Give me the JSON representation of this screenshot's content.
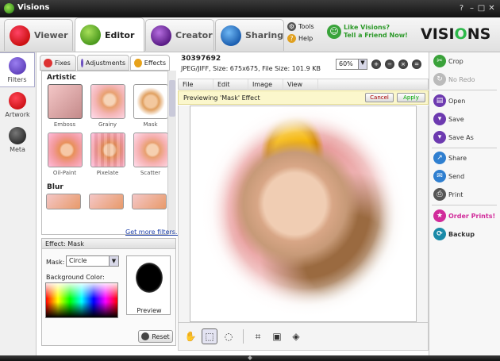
{
  "window": {
    "title": "Visions",
    "controls": [
      "?",
      "–",
      "□",
      "✕"
    ]
  },
  "nav": {
    "tabs": [
      {
        "label": "Viewer",
        "color": "#d42626"
      },
      {
        "label": "Editor",
        "color": "#6bb32d"
      },
      {
        "label": "Creator",
        "color": "#7a2fa5"
      },
      {
        "label": "Sharing",
        "color": "#2f7fd0"
      }
    ],
    "tools_label": "Tools",
    "help_label": "Help",
    "promo_line1": "Like Visions?",
    "promo_line2": "Tell a Friend Now!",
    "brand": "VISIONS"
  },
  "leftnav": {
    "items": [
      {
        "label": "Filters"
      },
      {
        "label": "Artwork"
      },
      {
        "label": "Meta"
      }
    ]
  },
  "subtabs": {
    "fixes": "Fixes",
    "adjustments": "Adjustments",
    "effects": "Effects"
  },
  "filters": {
    "section_artistic": "Artistic",
    "artistic": [
      {
        "label": "Emboss"
      },
      {
        "label": "Grainy"
      },
      {
        "label": "Mask"
      },
      {
        "label": "Oil-Paint"
      },
      {
        "label": "Pixelate"
      },
      {
        "label": "Scatter"
      }
    ],
    "section_blur": "Blur",
    "more_link": "Get more filters..."
  },
  "effect_panel": {
    "header": "Effect: Mask",
    "mask_label": "Mask:",
    "mask_value": "Circle",
    "bg_color_label": "Background Color:",
    "preview_label": "Preview",
    "reset_label": "Reset"
  },
  "file": {
    "id": "30397692",
    "info": "JPEG/JIFF, Size: 675x675, File Size: 101.9 KB",
    "zoom": "60%"
  },
  "editor_menu": {
    "file": "File",
    "edit": "Edit",
    "image": "Image",
    "view": "View"
  },
  "previewbar": {
    "text": "Previewing 'Mask' Effect",
    "cancel": "Cancel",
    "apply": "Apply"
  },
  "right_actions": {
    "crop": "Crop",
    "redo": "No Redo",
    "open": "Open",
    "save": "Save",
    "save_as": "Save As",
    "share": "Share",
    "send": "Send",
    "print": "Print",
    "order_prints": "Order Prints!",
    "backup": "Backup"
  }
}
